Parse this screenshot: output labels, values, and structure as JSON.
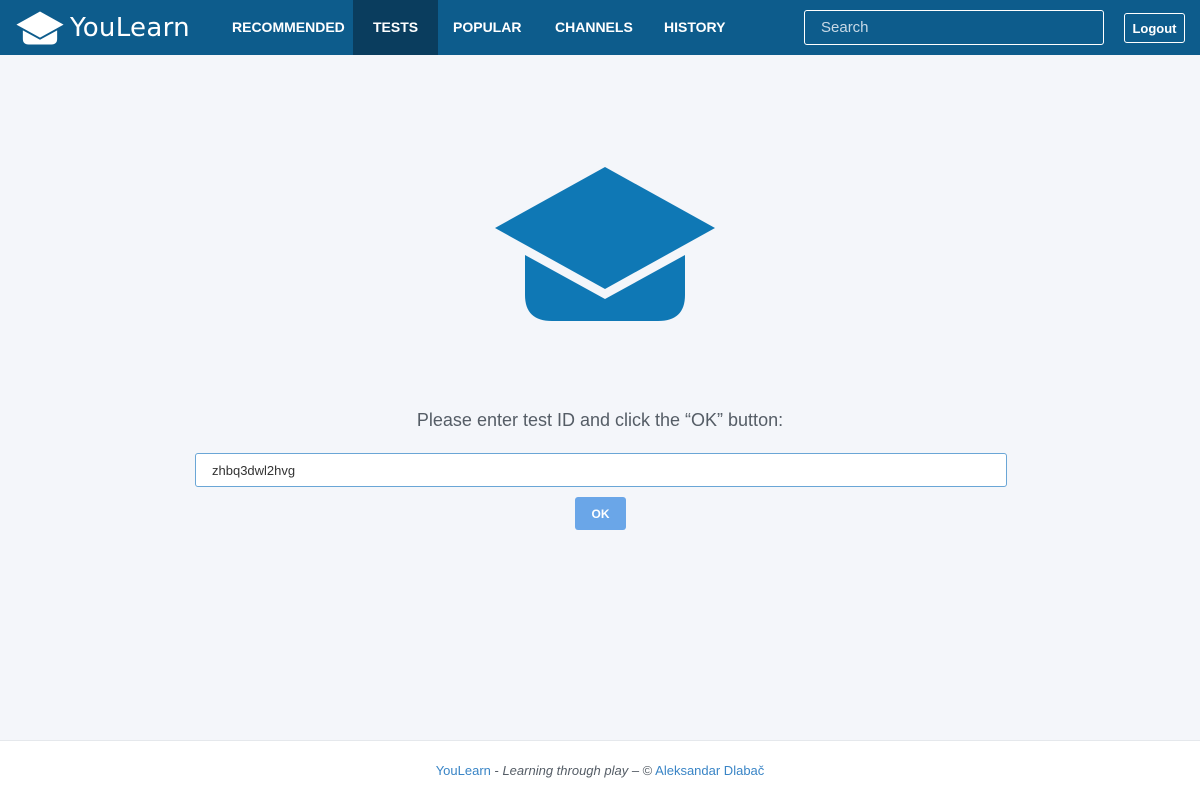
{
  "header": {
    "brand": "YouLearn",
    "nav": [
      {
        "label": "RECOMMENDED"
      },
      {
        "label": "TESTS"
      },
      {
        "label": "POPULAR"
      },
      {
        "label": "CHANNELS"
      },
      {
        "label": "HISTORY"
      }
    ],
    "active_nav": "TESTS",
    "search_placeholder": "Search",
    "logout_label": "Logout"
  },
  "main": {
    "icon": "graduation-cap-icon",
    "prompt": "Please enter test ID and click the “OK” button:",
    "test_id_value": "zhbq3dwl2hvg",
    "ok_label": "OK"
  },
  "footer": {
    "brand_link": "YouLearn",
    "separator": " - ",
    "tagline": "Learning through play",
    "copyright": " – © ",
    "author_link": "Aleksandar Dlabač"
  },
  "colors": {
    "navbar": "#0d5c8c",
    "nav_active": "#0a3d5e",
    "icon": "#0f78b5",
    "button": "#6aa6e8",
    "page_background": "#f4f6fa"
  }
}
